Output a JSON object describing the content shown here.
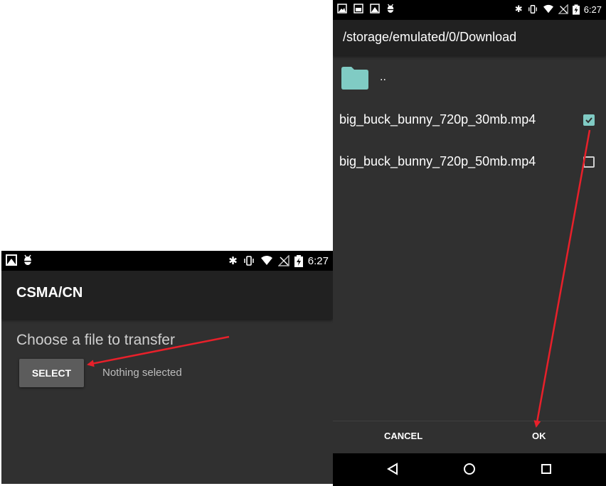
{
  "left_screen": {
    "status_bar": {
      "time": "6:27",
      "icons": [
        "image-icon",
        "android-debug-icon",
        "bluetooth-icon",
        "vibrate-icon",
        "wifi-icon",
        "no-signal-icon",
        "battery-charging-icon"
      ]
    },
    "app_title": "CSMA/CN",
    "prompt": "Choose a file to transfer",
    "select_button": "SELECT",
    "selection_status": "Nothing selected"
  },
  "right_screen": {
    "status_bar": {
      "time": "6:27",
      "icons": [
        "gallery-icon",
        "image-icon",
        "image-icon",
        "android-debug-icon",
        "bluetooth-icon",
        "vibrate-icon",
        "wifi-icon",
        "no-signal-icon",
        "battery-charging-icon"
      ]
    },
    "path_title": "/storage/emulated/0/Download",
    "parent_dir_label": "..",
    "files": [
      {
        "name": "big_buck_bunny_720p_30mb.mp4",
        "checked": true
      },
      {
        "name": "big_buck_bunny_720p_50mb.mp4",
        "checked": false
      }
    ],
    "cancel_button": "CANCEL",
    "ok_button": "OK",
    "nav_icons": [
      "back-icon",
      "home-icon",
      "recents-icon"
    ]
  },
  "colors": {
    "accent": "#80cbc4",
    "annotation_arrow": "#e8202a",
    "background": "#303030"
  }
}
